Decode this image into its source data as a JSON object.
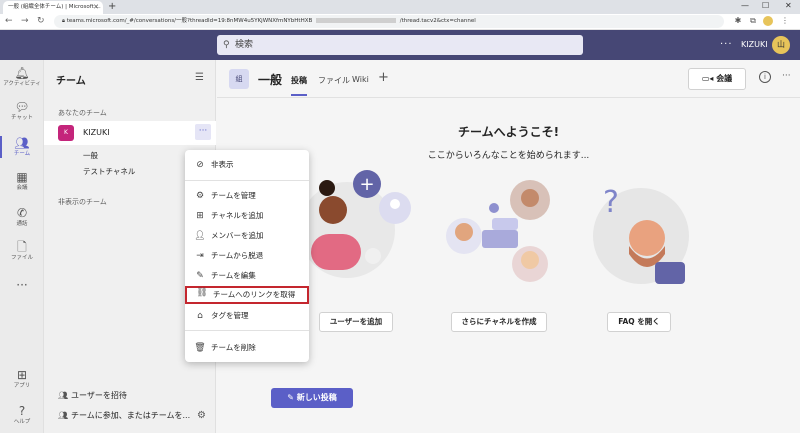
{
  "browser": {
    "tab_title": "一般 (組織全体チーム) | Microsoft ...",
    "url_prefix": "teams.microsoft.com/_#/conversations/一般?threadId=19:8nMW4u5YKjWNXfmNYbHtHXB",
    "url_suffix": "/thread.tacv2&ctx=channel"
  },
  "header": {
    "search_placeholder": "検索",
    "user_name": "KIZUKI",
    "avatar_initials": "山"
  },
  "appbar": {
    "items": [
      {
        "label": "アクティビティ",
        "icon": "bell-icon"
      },
      {
        "label": "チャット",
        "icon": "chat-icon"
      },
      {
        "label": "チーム",
        "icon": "teams-icon"
      },
      {
        "label": "会議",
        "icon": "calendar-icon"
      },
      {
        "label": "通話",
        "icon": "phone-icon"
      },
      {
        "label": "ファイル",
        "icon": "file-icon"
      },
      {
        "label": "",
        "icon": "more-icon"
      },
      {
        "label": "アプリ",
        "icon": "apps-icon"
      },
      {
        "label": "ヘルプ",
        "icon": "help-icon"
      }
    ]
  },
  "teams_panel": {
    "title": "チーム",
    "your_teams_label": "あなたのチーム",
    "team": {
      "name": "KIZUKI",
      "avatar": "K"
    },
    "channels": [
      "一般",
      "テストチャネル"
    ],
    "hidden_teams_label": "非表示のチーム",
    "invite_label": "ユーザーを招待",
    "join_label": "チームに参加、またはチームを..."
  },
  "main": {
    "channel_badge": "組",
    "channel_name": "一般",
    "tabs": [
      "投稿",
      "ファイル",
      "Wiki"
    ],
    "meet_label": "会議",
    "welcome_title": "チームへようこそ!",
    "welcome_sub": "ここからいろんなことを始められます...",
    "actions": [
      "ユーザーを追加",
      "さらにチャネルを作成",
      "FAQ を開く"
    ],
    "new_post_label": "新しい投稿"
  },
  "context_menu": {
    "items": [
      {
        "label": "非表示",
        "icon": "hide-icon"
      },
      {
        "label": "チームを管理",
        "icon": "gear-icon"
      },
      {
        "label": "チャネルを追加",
        "icon": "add-channel-icon"
      },
      {
        "label": "メンバーを追加",
        "icon": "add-member-icon"
      },
      {
        "label": "チームから脱退",
        "icon": "leave-icon"
      },
      {
        "label": "チームを編集",
        "icon": "edit-icon"
      },
      {
        "label": "チームへのリンクを取得",
        "icon": "link-icon"
      },
      {
        "label": "タグを管理",
        "icon": "tag-icon"
      },
      {
        "label": "チームを削除",
        "icon": "trash-icon"
      }
    ],
    "highlight_color": "#c4262e"
  },
  "colors": {
    "brand": "#464775",
    "accent": "#5b5fc7"
  }
}
